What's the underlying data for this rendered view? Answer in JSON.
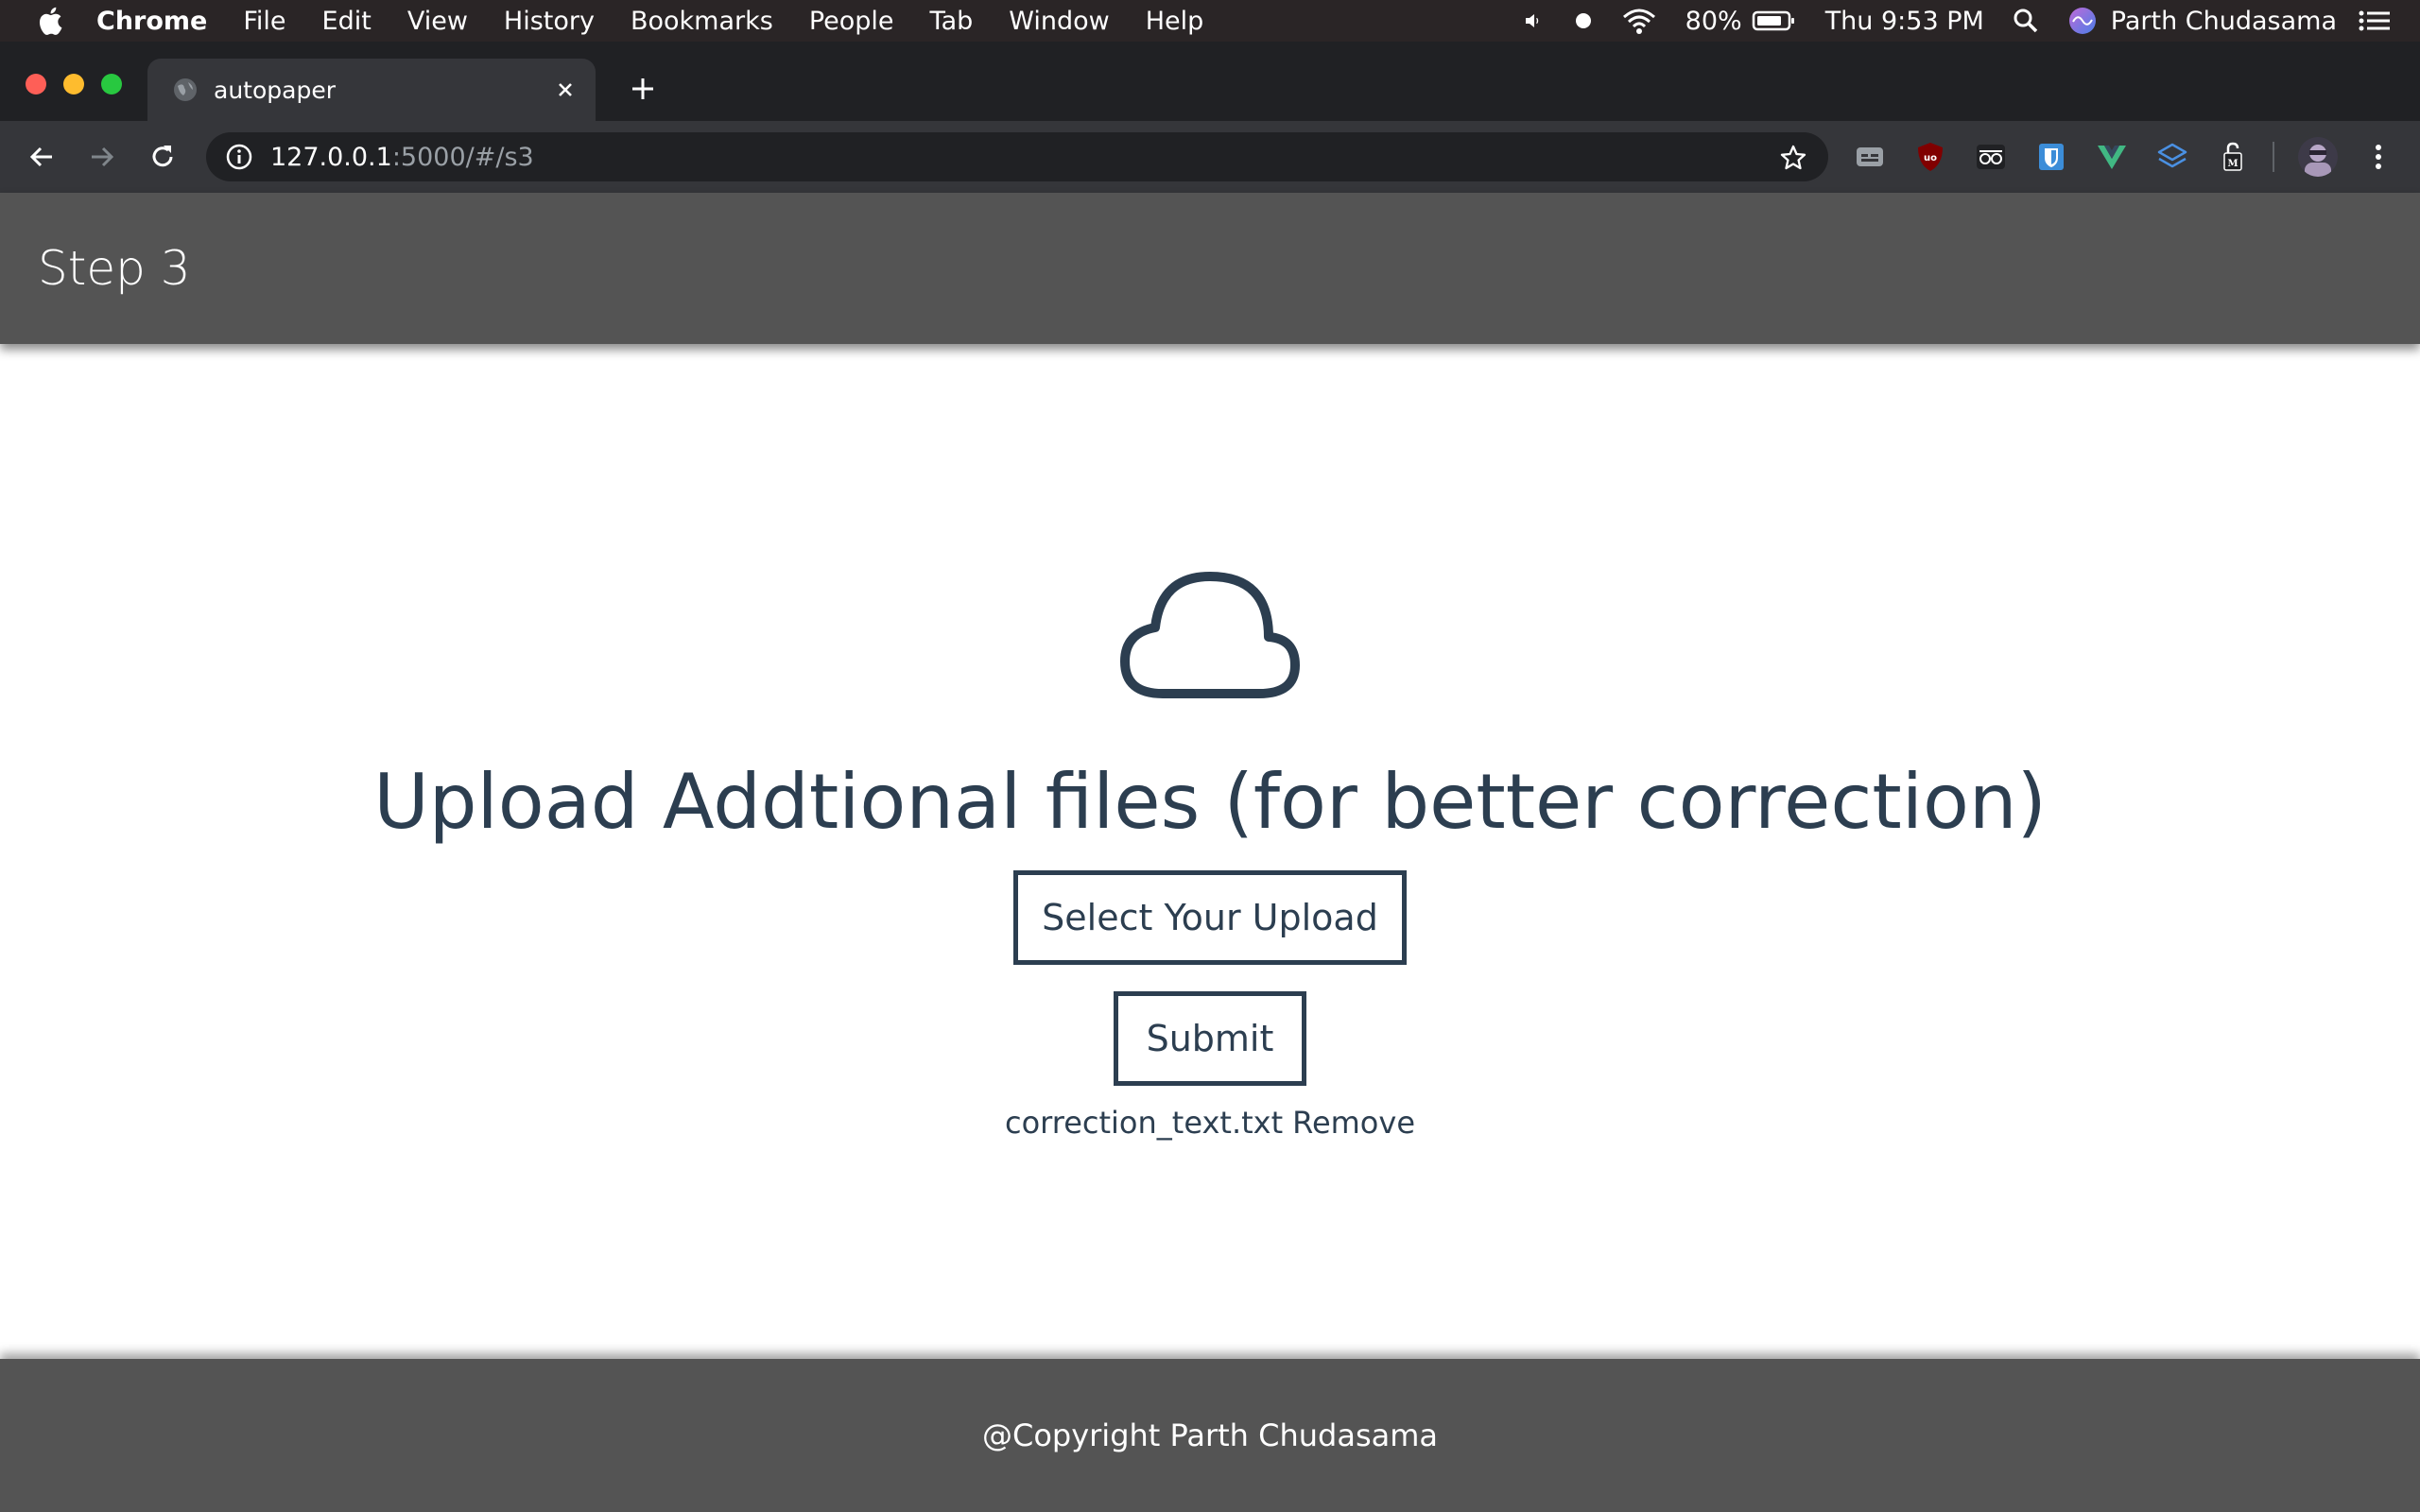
{
  "menubar": {
    "app_name": "Chrome",
    "items": [
      "File",
      "Edit",
      "View",
      "History",
      "Bookmarks",
      "People",
      "Tab",
      "Window",
      "Help"
    ],
    "battery": "80%",
    "datetime": "Thu 9:53 PM",
    "user": "Parth Chudasama"
  },
  "tab": {
    "title": "autopaper"
  },
  "omnibox": {
    "host": "127.0.0.1",
    "path": ":5000/#/s3"
  },
  "extensions": [
    "caption-icon",
    "ublock-icon",
    "glasses-icon",
    "bitwarden-icon",
    "vue-devtools-icon",
    "layers-icon",
    "lock-m-icon"
  ],
  "page": {
    "header_title": "Step 3",
    "heading": "Upload Addtional files (for better correction)",
    "select_button": "Select Your Upload",
    "submit_button": "Submit",
    "file_name": "correction_text.txt",
    "remove_label": "Remove",
    "footer": "@Copyright Parth Chudasama"
  },
  "colors": {
    "header_bg": "#545454",
    "text_primary": "#2c3e50"
  }
}
